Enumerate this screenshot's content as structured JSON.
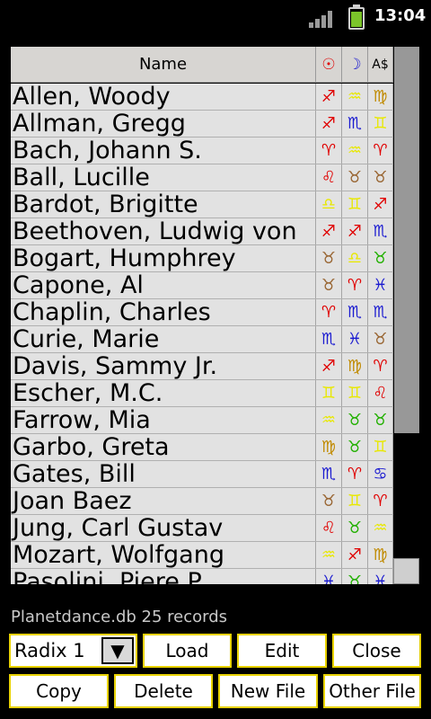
{
  "status_bar": {
    "time": "13:04"
  },
  "table": {
    "headers": {
      "name": "Name",
      "sun": "☉",
      "moon": "☽",
      "asc": "A$"
    },
    "rows": [
      {
        "name": "Allen, Woody",
        "sun": "♐",
        "moon": "♒",
        "asc": "♍"
      },
      {
        "name": "Allman, Gregg",
        "sun": "♐",
        "moon": "♏",
        "asc": "♊"
      },
      {
        "name": "Bach, Johann S.",
        "sun": "♈",
        "moon": "♒",
        "asc": "♈"
      },
      {
        "name": "Ball, Lucille",
        "sun": "♌",
        "moon": "♉",
        "asc": "♉"
      },
      {
        "name": "Bardot, Brigitte",
        "sun": "♎",
        "moon": "♊",
        "asc": "♐"
      },
      {
        "name": "Beethoven, Ludwig von",
        "sun": "♐",
        "moon": "♐",
        "asc": "♏"
      },
      {
        "name": "Bogart, Humphrey",
        "sun": "♉",
        "moon": "♎",
        "asc": "♉"
      },
      {
        "name": "Capone, Al",
        "sun": "♉",
        "moon": "♈",
        "asc": "♓"
      },
      {
        "name": "Chaplin, Charles",
        "sun": "♈",
        "moon": "♏",
        "asc": "♏"
      },
      {
        "name": "Curie, Marie",
        "sun": "♏",
        "moon": "♓",
        "asc": "♉"
      },
      {
        "name": "Davis, Sammy Jr.",
        "sun": "♐",
        "moon": "♍",
        "asc": "♈"
      },
      {
        "name": "Escher, M.C.",
        "sun": "♊",
        "moon": "♊",
        "asc": "♌"
      },
      {
        "name": "Farrow, Mia",
        "sun": "♒",
        "moon": "♉",
        "asc": "♉"
      },
      {
        "name": "Garbo, Greta",
        "sun": "♍",
        "moon": "♉",
        "asc": "♊"
      },
      {
        "name": "Gates, Bill",
        "sun": "♏",
        "moon": "♈",
        "asc": "♋"
      },
      {
        "name": "Joan Baez",
        "sun": "♉",
        "moon": "♊",
        "asc": "♈"
      },
      {
        "name": "Jung, Carl Gustav",
        "sun": "♌",
        "moon": "♉",
        "asc": "♒"
      },
      {
        "name": "Mozart, Wolfgang",
        "sun": "♒",
        "moon": "♐",
        "asc": "♍"
      },
      {
        "name": "Pasolini, Piere P.",
        "sun": "♓",
        "moon": "♉",
        "asc": "♓"
      }
    ]
  },
  "sign_colors": {
    "♈": "#e00000",
    "♌": "#e00000",
    "♐": "#e00000",
    "♊": "#e8e800",
    "♎": "#e8e800",
    "♒": "#e8e800",
    "♉": "#996633",
    "♍": "#c08a00",
    "♏": "#1a1ad0",
    "♓": "#1a1ad0",
    "♋": "#1a1ad0",
    "♉green": "#22b000"
  },
  "header_colors": {
    "sun": "#e00000",
    "moon": "#1a1ad0",
    "asc": "#000000"
  },
  "footer": {
    "status": "Planetdance.db 25 records",
    "radix_value": "Radix 1",
    "buttons": {
      "load": "Load",
      "edit": "Edit",
      "close": "Close",
      "copy": "Copy",
      "delete": "Delete",
      "new_file": "New File",
      "other_file": "Other File"
    }
  }
}
